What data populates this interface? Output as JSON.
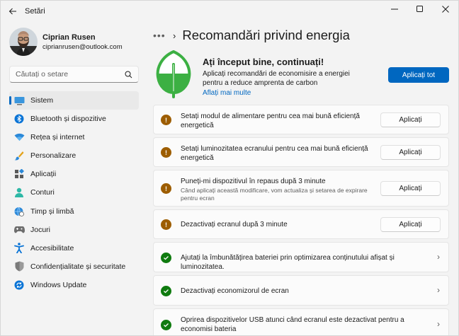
{
  "window": {
    "title": "Setări"
  },
  "profile": {
    "name": "Ciprian Rusen",
    "email": "ciprianrusen@outlook.com"
  },
  "search": {
    "placeholder": "Căutați o setare"
  },
  "nav": {
    "items": [
      {
        "label": "Sistem",
        "icon": "monitor-icon",
        "active": true
      },
      {
        "label": "Bluetooth și dispozitive",
        "icon": "bluetooth-icon"
      },
      {
        "label": "Rețea și internet",
        "icon": "wifi-icon"
      },
      {
        "label": "Personalizare",
        "icon": "brush-icon"
      },
      {
        "label": "Aplicații",
        "icon": "apps-icon"
      },
      {
        "label": "Conturi",
        "icon": "person-icon"
      },
      {
        "label": "Timp și limbă",
        "icon": "globe-clock-icon"
      },
      {
        "label": "Jocuri",
        "icon": "gamepad-icon"
      },
      {
        "label": "Accesibilitate",
        "icon": "accessibility-icon"
      },
      {
        "label": "Confidențialitate și securitate",
        "icon": "shield-icon"
      },
      {
        "label": "Windows Update",
        "icon": "sync-icon"
      }
    ]
  },
  "header": {
    "more": "•••",
    "chevron": "›",
    "title": "Recomandări privind energia"
  },
  "hero": {
    "heading": "Ați început bine, continuați!",
    "description": "Aplicați recomandări de economisire a energiei pentru a reduce amprenta de carbon",
    "link": "Aflați mai multe",
    "apply_all": "Aplicați tot"
  },
  "recommendations": [
    {
      "title": "Setați modul de alimentare pentru cea mai bună eficiență energetică",
      "subtitle": "",
      "status": "warning",
      "action": "Aplicați"
    },
    {
      "title": "Setați luminozitatea ecranului pentru cea mai bună eficiență energetică",
      "subtitle": "",
      "status": "warning",
      "action": "Aplicați"
    },
    {
      "title": "Puneți-mi dispozitivul în repaus după 3 minute",
      "subtitle": "Când aplicați această modificare, vom actualiza și setarea de expirare pentru ecran",
      "status": "warning",
      "action": "Aplicați"
    },
    {
      "title": "Dezactivați ecranul după 3 minute",
      "subtitle": "",
      "status": "warning",
      "action": "Aplicați"
    },
    {
      "title": "Ajutați la îmbunătățirea bateriei prin optimizarea conținutului afișat și luminozitatea.",
      "subtitle": "",
      "status": "done",
      "action": ""
    },
    {
      "title": "Dezactivați economizorul de ecran",
      "subtitle": "",
      "status": "done",
      "action": ""
    },
    {
      "title": "Oprirea dispozitivelor USB atunci când ecranul este dezactivat pentru a economisi bateria",
      "subtitle": "",
      "status": "done",
      "action": ""
    }
  ],
  "colors": {
    "accent": "#0067c0",
    "warning": "#9d5d00",
    "success": "#0f7b0f",
    "leaf": "#3cb043"
  }
}
